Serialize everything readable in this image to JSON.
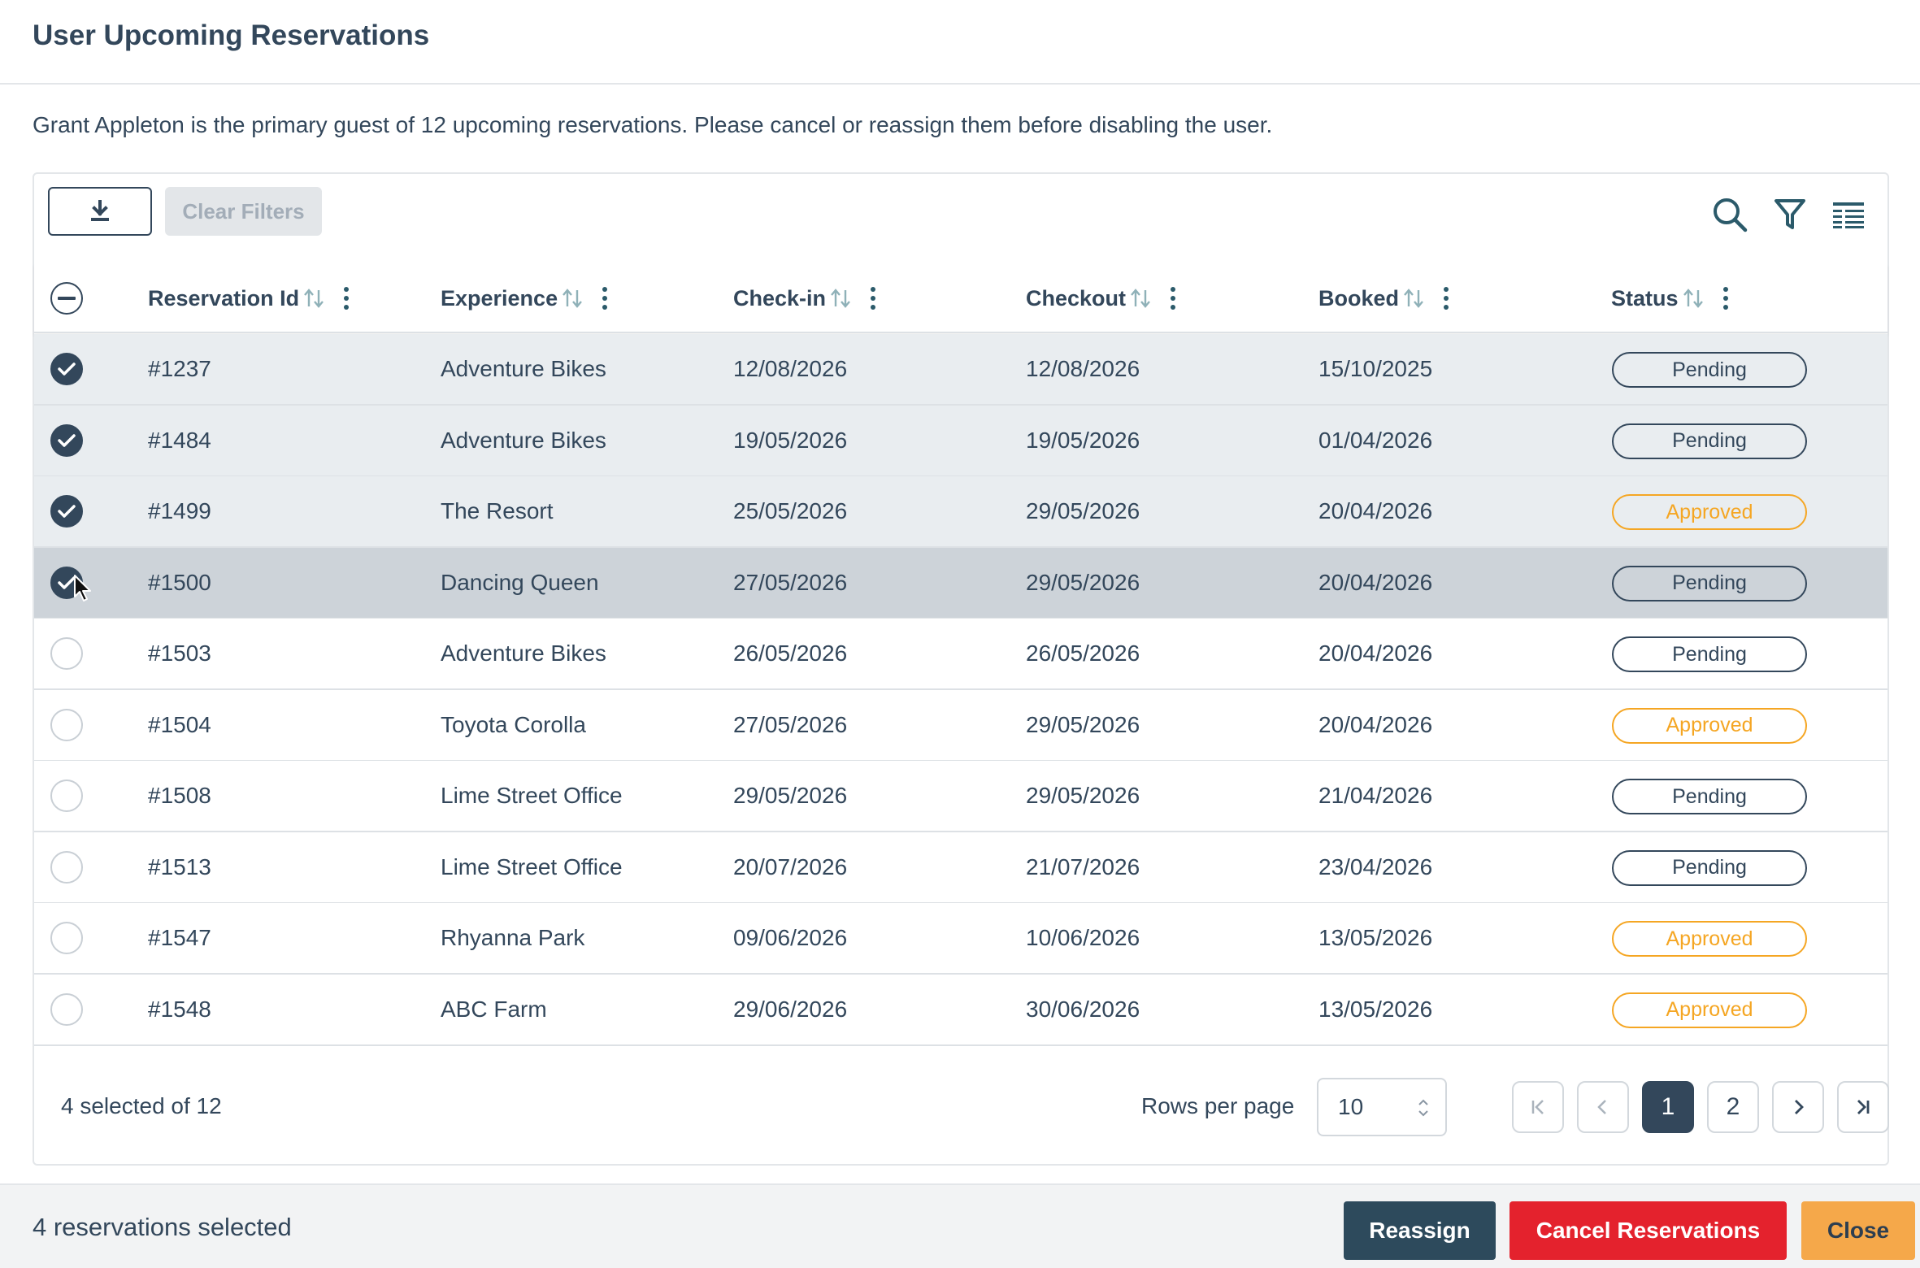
{
  "modal": {
    "title": "User Upcoming Reservations",
    "intro": "Grant Appleton is the primary guest of 12 upcoming reservations. Please cancel or reassign them before disabling the user."
  },
  "toolbar": {
    "download_icon": "download-icon",
    "clear_filters": "Clear Filters",
    "icons": [
      "search-icon",
      "filter-icon",
      "columns-icon"
    ]
  },
  "table": {
    "columns": [
      "Reservation Id",
      "Experience",
      "Check-in",
      "Checkout",
      "Booked",
      "Status"
    ],
    "rows": [
      {
        "id": "#1237",
        "experience": "Adventure Bikes",
        "checkin": "12/08/2026",
        "checkout": "12/08/2026",
        "booked": "15/10/2025",
        "status": "Pending",
        "checked": true
      },
      {
        "id": "#1484",
        "experience": "Adventure Bikes",
        "checkin": "19/05/2026",
        "checkout": "19/05/2026",
        "booked": "01/04/2026",
        "status": "Pending",
        "checked": true
      },
      {
        "id": "#1499",
        "experience": "The Resort",
        "checkin": "25/05/2026",
        "checkout": "29/05/2026",
        "booked": "20/04/2026",
        "status": "Approved",
        "checked": true
      },
      {
        "id": "#1500",
        "experience": "Dancing Queen",
        "checkin": "27/05/2026",
        "checkout": "29/05/2026",
        "booked": "20/04/2026",
        "status": "Pending",
        "checked": true
      },
      {
        "id": "#1503",
        "experience": "Adventure Bikes",
        "checkin": "26/05/2026",
        "checkout": "26/05/2026",
        "booked": "20/04/2026",
        "status": "Pending",
        "checked": false
      },
      {
        "id": "#1504",
        "experience": "Toyota Corolla",
        "checkin": "27/05/2026",
        "checkout": "29/05/2026",
        "booked": "20/04/2026",
        "status": "Approved",
        "checked": false
      },
      {
        "id": "#1508",
        "experience": "Lime Street Office",
        "checkin": "29/05/2026",
        "checkout": "29/05/2026",
        "booked": "21/04/2026",
        "status": "Pending",
        "checked": false
      },
      {
        "id": "#1513",
        "experience": "Lime Street Office",
        "checkin": "20/07/2026",
        "checkout": "21/07/2026",
        "booked": "23/04/2026",
        "status": "Pending",
        "checked": false
      },
      {
        "id": "#1547",
        "experience": "Rhyanna Park",
        "checkin": "09/06/2026",
        "checkout": "10/06/2026",
        "booked": "13/05/2026",
        "status": "Approved",
        "checked": false
      },
      {
        "id": "#1548",
        "experience": "ABC Farm",
        "checkin": "29/06/2026",
        "checkout": "30/06/2026",
        "booked": "13/05/2026",
        "status": "Approved",
        "checked": false
      }
    ]
  },
  "footer": {
    "selected_text": "4 selected of 12",
    "rows_per_page_label": "Rows per page",
    "rows_per_page_value": "10",
    "pages": [
      "1",
      "2"
    ],
    "current_page": "1"
  },
  "bottom_bar": {
    "text": "4 reservations selected",
    "reassign": "Reassign",
    "cancel": "Cancel Reservations",
    "close": "Close"
  },
  "colors": {
    "primary": "#33475b",
    "pending": "#33475b",
    "approved": "#f5a623",
    "danger": "#e4222d",
    "warning": "#f5a84a"
  }
}
